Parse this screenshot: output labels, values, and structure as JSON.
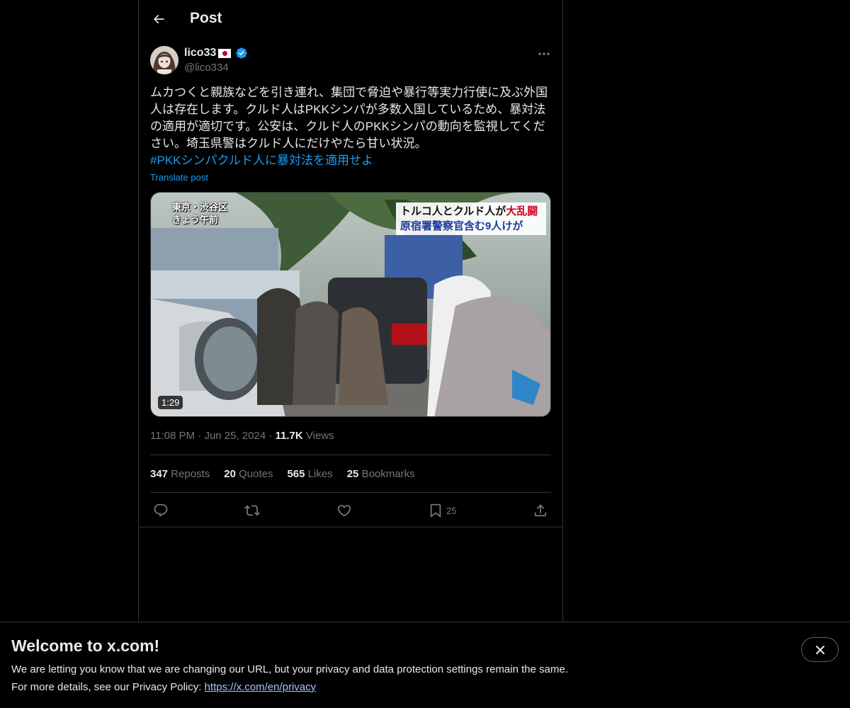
{
  "header": {
    "title": "Post"
  },
  "author": {
    "display_name": "lico33",
    "flag": "japan-flag-icon",
    "verified": true,
    "handle": "@lico334"
  },
  "tweet": {
    "text": "ムカつくと親族などを引き連れ、集団で脅迫や暴行等実力行使に及ぶ外国人は存在します。クルド人はPKKシンパが多数入国しているため、暴対法の適用が適切です。公安は、クルド人のPKKシンパの動向を監視してください。埼玉県警はクルド人にだけやたら甘い状況。",
    "hashtag": "#PKKシンパクルド人に暴対法を適用せよ",
    "translate_label": "Translate post"
  },
  "media": {
    "duration": "1:29",
    "caption_left_1": "東京・渋谷区",
    "caption_left_2": "きょう午前",
    "caption_right_1a": "トルコ人とクルド人が",
    "caption_right_1b": "大乱闘",
    "caption_right_2": "原宿署警察官含む9人けが"
  },
  "meta": {
    "time": "11:08 PM",
    "date": "Jun 25, 2024",
    "views_count": "11.7K",
    "views_label": "Views"
  },
  "stats": {
    "reposts_count": "347",
    "reposts_label": "Reposts",
    "quotes_count": "20",
    "quotes_label": "Quotes",
    "likes_count": "565",
    "likes_label": "Likes",
    "bookmarks_count": "25",
    "bookmarks_label": "Bookmarks"
  },
  "actions": {
    "bookmark_count": "25"
  },
  "banner": {
    "title": "Welcome to x.com!",
    "line1": "We are letting you know that we are changing our URL, but your privacy and data protection settings remain the same.",
    "line2_prefix": "For more details, see our Privacy Policy: ",
    "link": "https://x.com/en/privacy"
  },
  "colors": {
    "accent": "#1d9bf0",
    "background": "#000000",
    "muted": "#71767b",
    "border": "#2f3336"
  }
}
